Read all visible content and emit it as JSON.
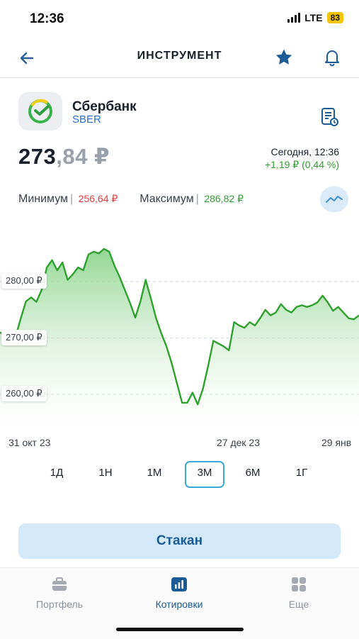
{
  "status": {
    "time": "12:36",
    "network": "LTE",
    "battery": "83"
  },
  "header": {
    "title": "ИНСТРУМЕНТ",
    "back_icon": "arrow-left-icon",
    "favorite_icon": "star-icon",
    "alert_icon": "bell-icon"
  },
  "instrument": {
    "name": "Сбербанк",
    "ticker": "SBER",
    "price_int": "273",
    "price_frac": ",84 ₽",
    "time_label": "Сегодня, 12:36",
    "change": "+1,19 ₽ (0,44 %)",
    "min_label": "Минимум",
    "min_value": "256,64 ₽",
    "max_label": "Максимум",
    "max_value": "286,82 ₽"
  },
  "colors": {
    "accent": "#1b5b96",
    "up": "#2f9e2f",
    "down": "#e23b3b",
    "line": "#2ea12e"
  },
  "chart_data": {
    "type": "area",
    "y_ticks": [
      "280,00 ₽",
      "270,00 ₽",
      "260,00 ₽"
    ],
    "x_ticks": [
      "31 окт 23",
      "27 дек 23",
      "29 янв"
    ],
    "ylim": [
      255,
      290
    ],
    "values": [
      271.0,
      270.5,
      271.2,
      270.2,
      273.5,
      276.5,
      277.2,
      276.4,
      278.5,
      282.5,
      283.8,
      282.0,
      283.4,
      280.3,
      281.3,
      282.5,
      282.0,
      284.8,
      285.3,
      285.0,
      285.8,
      285.3,
      282.8,
      280.8,
      278.5,
      276.2,
      273.6,
      276.5,
      280.3,
      277.0,
      273.5,
      270.8,
      268.5,
      265.5,
      262.0,
      258.5,
      258.5,
      260.3,
      258.2,
      261.0,
      265.0,
      269.5,
      269.0,
      268.5,
      267.8,
      272.8,
      272.2,
      271.8,
      272.8,
      272.2,
      273.5,
      275.0,
      274.0,
      274.5,
      276.0,
      275.0,
      274.5,
      275.5,
      275.8,
      275.5,
      275.8,
      276.3,
      277.5,
      276.3,
      274.8,
      275.5,
      274.5,
      273.5,
      273.3,
      274.0
    ]
  },
  "periods": [
    "1Д",
    "1Н",
    "1М",
    "3М",
    "6М",
    "1Г"
  ],
  "active_period": "3М",
  "action_button": "Стакан",
  "bottom_nav": [
    {
      "label": "Портфель",
      "icon": "briefcase-icon"
    },
    {
      "label": "Котировки",
      "icon": "chart-bars-icon"
    },
    {
      "label": "Еще",
      "icon": "grid-icon"
    }
  ]
}
